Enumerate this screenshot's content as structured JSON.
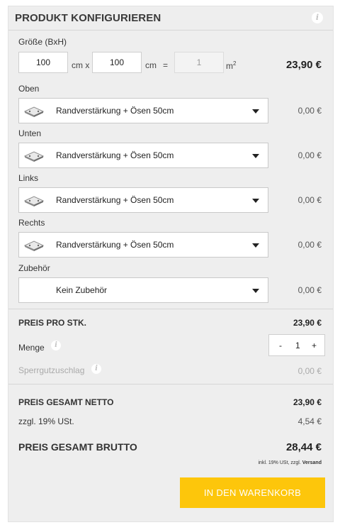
{
  "header": {
    "title": "PRODUKT KONFIGURIEREN"
  },
  "size": {
    "label": "Größe (BxH)",
    "width_value": "100",
    "width_unit": "cm x",
    "height_value": "100",
    "height_unit": "cm",
    "equals": "=",
    "area_value": "1",
    "area_unit": "m",
    "area_unit_sup": "2",
    "price": "23,90 €"
  },
  "options": [
    {
      "label": "Oben",
      "value": "Randverstärkung + Ösen 50cm",
      "price": "0,00 €",
      "thumb": "eyelet-thumbnail"
    },
    {
      "label": "Unten",
      "value": "Randverstärkung + Ösen 50cm",
      "price": "0,00 €",
      "thumb": "eyelet-thumbnail"
    },
    {
      "label": "Links",
      "value": "Randverstärkung + Ösen 50cm",
      "price": "0,00 €",
      "thumb": "eyelet-thumbnail"
    },
    {
      "label": "Rechts",
      "value": "Randverstärkung + Ösen 50cm",
      "price": "0,00 €",
      "thumb": "eyelet-thumbnail"
    },
    {
      "label": "Zubehör",
      "value": "Kein Zubehör",
      "price": "0,00 €",
      "thumb": ""
    }
  ],
  "summary": {
    "price_per_piece_label": "PREIS PRO STK.",
    "price_per_piece": "23,90 €",
    "quantity_label": "Menge",
    "quantity_minus": "-",
    "quantity_value": "1",
    "quantity_plus": "+",
    "bulky_label": "Sperrgutzuschlag",
    "bulky_price": "0,00 €"
  },
  "totals": {
    "net_label": "PREIS GESAMT NETTO",
    "net_price": "23,90 €",
    "vat_label": "zzgl. 19% USt.",
    "vat_price": "4,54 €",
    "gross_label": "PREIS GESAMT BRUTTO",
    "gross_price": "28,44 €",
    "note_prefix": "inkl. 19% USt, zzgl. ",
    "note_link": "Versand"
  },
  "cart_button": "IN DEN WARENKORB",
  "colors": {
    "accent": "#fdc60b",
    "panel": "#eeeeee",
    "info_icon": "#c4c4c4"
  }
}
